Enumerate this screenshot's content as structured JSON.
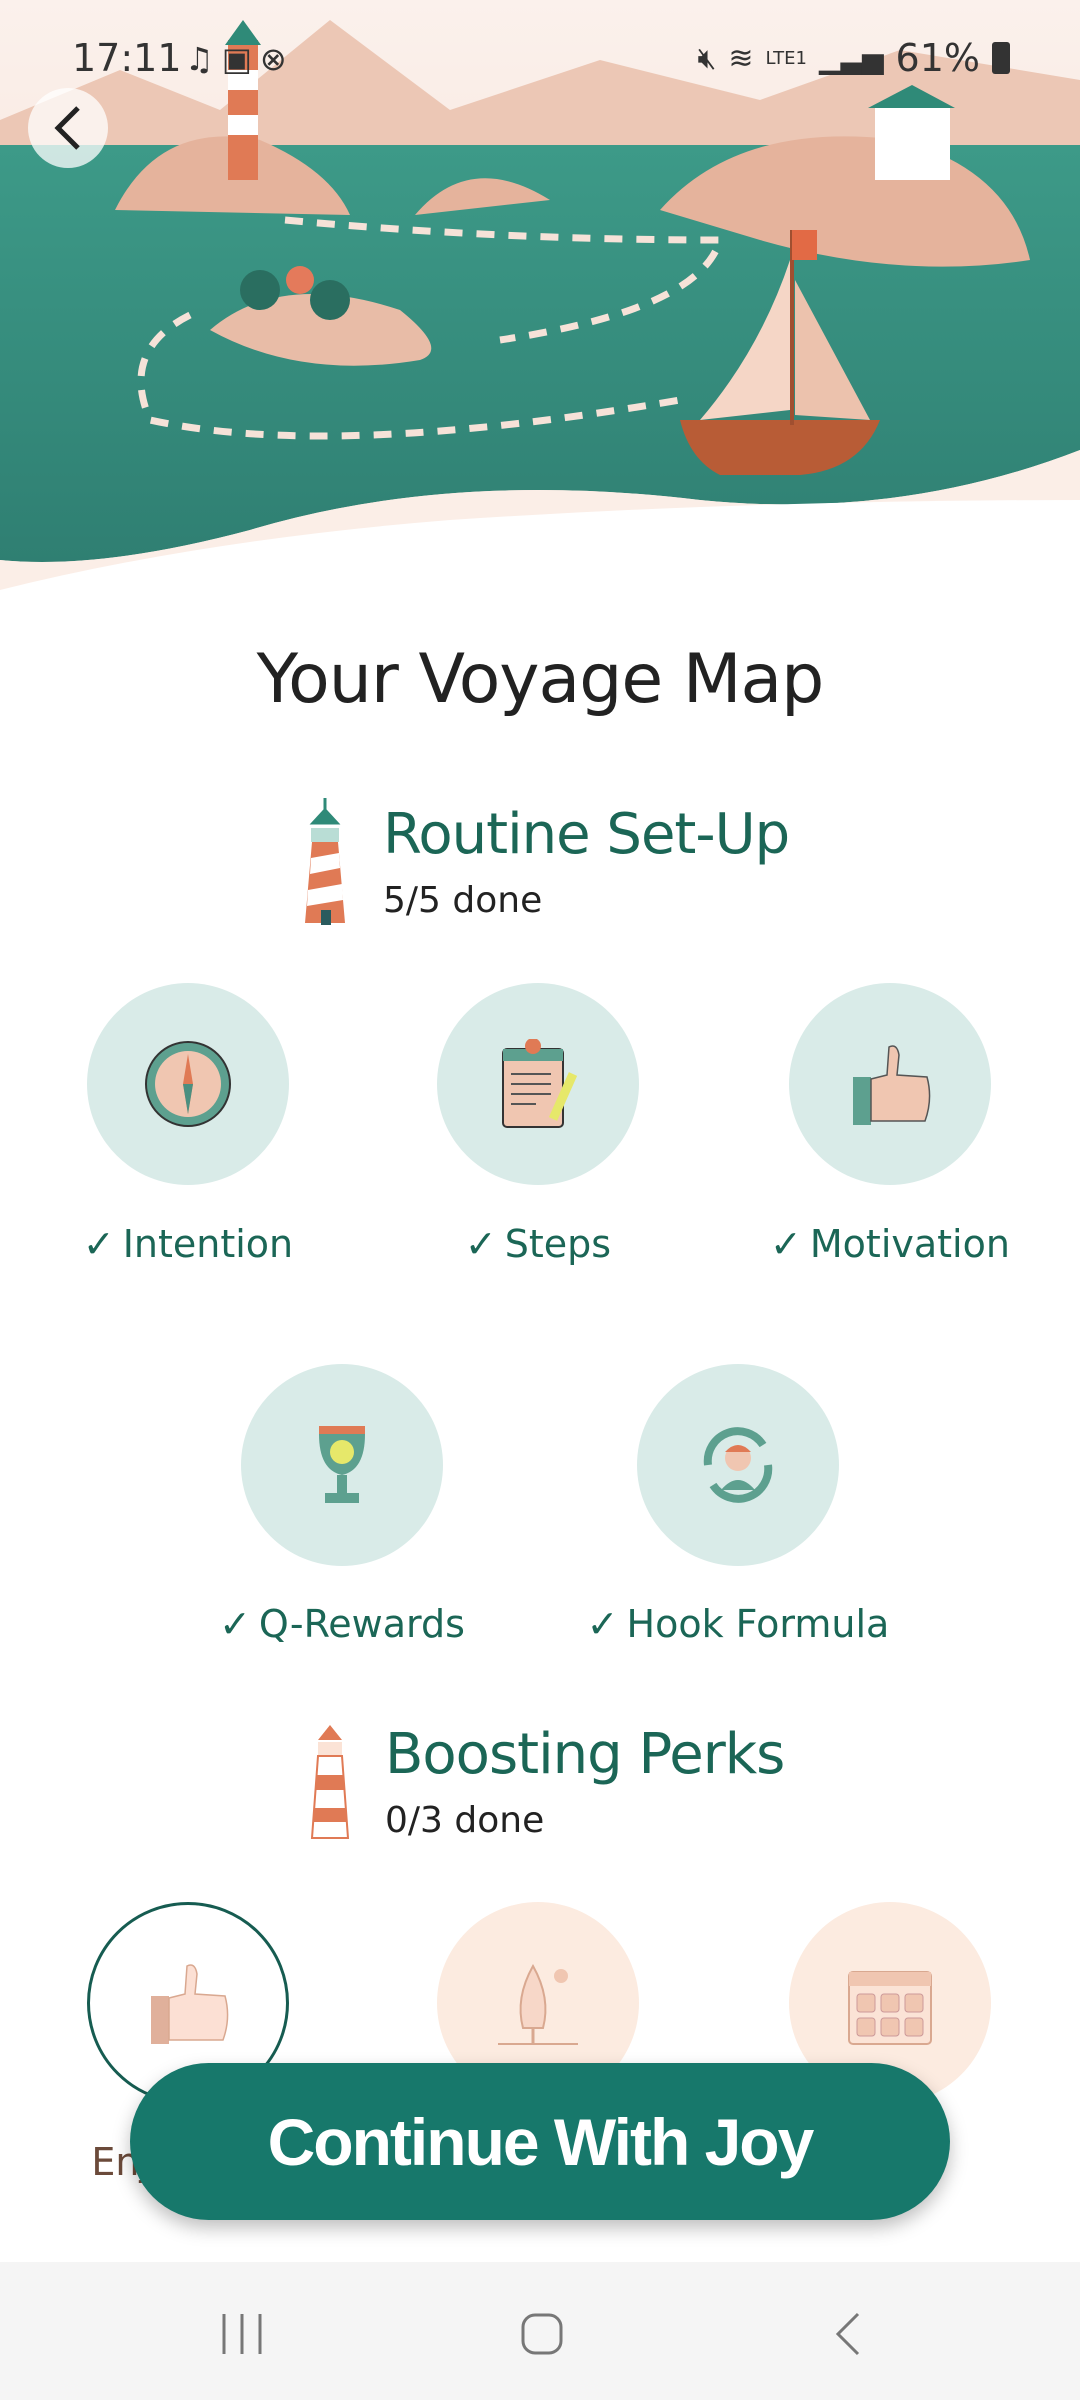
{
  "status_bar": {
    "time": "17:11",
    "battery": "61%",
    "network": "LTE1"
  },
  "header": {
    "title": "Your Voyage Map"
  },
  "sections": [
    {
      "title": "Routine Set-Up",
      "progress": "5/5 done",
      "items": [
        {
          "label": "Intention",
          "icon": "compass-icon",
          "done": true
        },
        {
          "label": "Steps",
          "icon": "clipboard-icon",
          "done": true
        },
        {
          "label": "Motivation",
          "icon": "thumbs-up-icon",
          "done": true
        },
        {
          "label": "Q-Rewards",
          "icon": "trophy-icon",
          "done": true
        },
        {
          "label": "Hook Formula",
          "icon": "person-cycle-icon",
          "done": true
        }
      ]
    },
    {
      "title": "Boosting Perks",
      "progress": "0/3 done",
      "items": [
        {
          "label": "Enj",
          "icon": "thumbs-up-icon",
          "done": false
        },
        {
          "icon": "tree-icon",
          "done": false
        },
        {
          "icon": "calendar-icon",
          "done": false
        }
      ]
    }
  ],
  "check_mark": "✓",
  "cta": {
    "label": "Continue With Joy"
  },
  "colors": {
    "accent": "#17786b",
    "heading": "#1b6656",
    "done_circle": "#d9ebe8",
    "todo_circle": "#fcebe0",
    "sea": "#3a8f80"
  }
}
